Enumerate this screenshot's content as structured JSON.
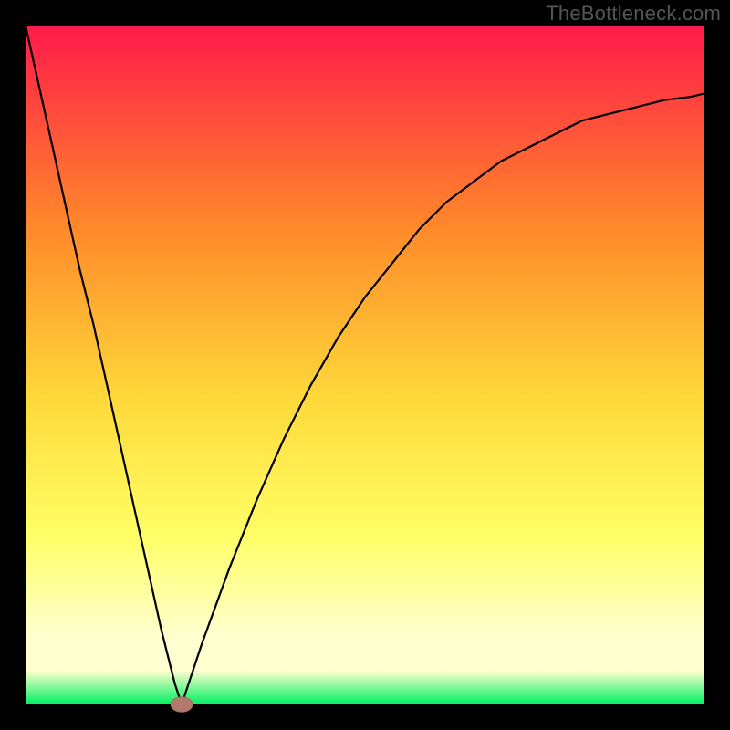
{
  "watermark": "TheBottleneck.com",
  "colors": {
    "frame": "#000000",
    "curve": "#000000",
    "marker_fill": "#b27a6e",
    "marker_stroke": "#a56a5e",
    "grad_top": "#ff1a4a",
    "grad_mid_upper": "#ff8a2a",
    "grad_mid": "#ffd93a",
    "grad_lower": "#ffff66",
    "grad_pale": "#ffffd0",
    "grad_bottom": "#00f060"
  },
  "chart_data": {
    "type": "line",
    "title": "",
    "xlabel": "",
    "ylabel": "",
    "xlim": [
      0,
      100
    ],
    "ylim": [
      0,
      100
    ],
    "series": [
      {
        "name": "bottleneck-curve",
        "x": [
          0,
          2,
          4,
          6,
          8,
          10,
          12,
          14,
          16,
          18,
          20,
          22,
          23,
          26,
          30,
          34,
          38,
          42,
          46,
          50,
          54,
          58,
          62,
          66,
          70,
          74,
          78,
          82,
          86,
          90,
          94,
          98,
          100
        ],
        "y": [
          100,
          91,
          82,
          73,
          64,
          56,
          47,
          38,
          29,
          20,
          11,
          3,
          0,
          9,
          20,
          30,
          39,
          47,
          54,
          60,
          65,
          70,
          74,
          77,
          80,
          82,
          84,
          86,
          87,
          88,
          89,
          89.5,
          90
        ]
      }
    ],
    "marker": {
      "x": 23,
      "y": 0,
      "rx": 1.6,
      "ry": 1.1
    },
    "gradient_stops_pct": [
      0,
      30,
      55,
      75,
      90,
      95,
      100
    ]
  }
}
